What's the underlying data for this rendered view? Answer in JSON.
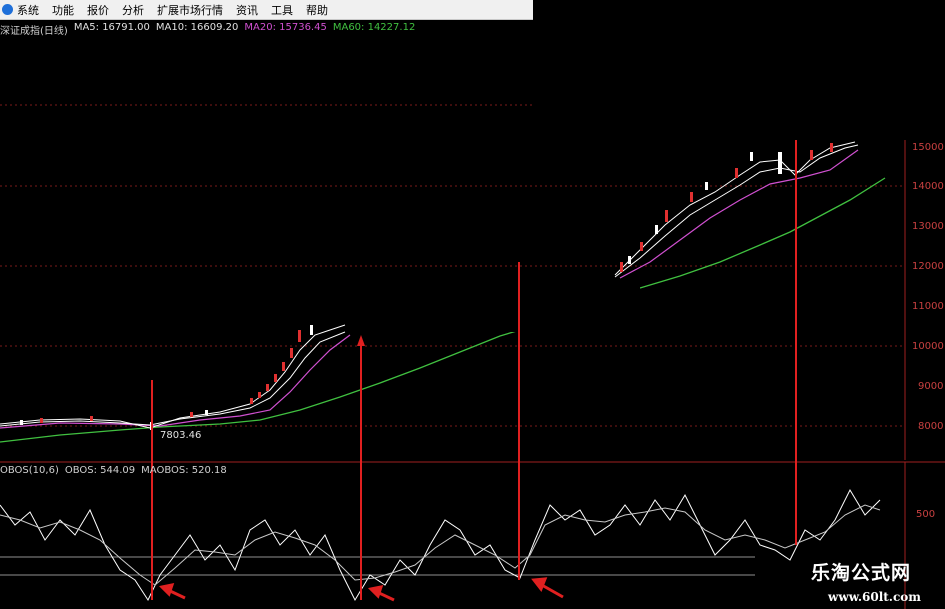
{
  "menu": {
    "items": [
      "系统",
      "功能",
      "报价",
      "分析",
      "扩展市场行情",
      "资讯",
      "工具",
      "帮助"
    ]
  },
  "price_legend": {
    "name": "深证成指(日线)",
    "ma5": "MA5: 16791.00",
    "ma10": "MA10: 16609.20",
    "ma20": "MA20: 15736.45",
    "ma60": "MA60: 14227.12"
  },
  "colors": {
    "ma5": "#ffffff",
    "ma10": "#ffffff",
    "ma20": "#d050d0",
    "ma60": "#40c040",
    "axis": "#c84040",
    "signal_line": "#e02020"
  },
  "low_price_label": "7803.46",
  "price_axis": [
    "15000",
    "14000",
    "13000",
    "12000",
    "11000",
    "10000",
    "9000",
    "8000"
  ],
  "obos_legend": {
    "name": "OBOS(10,6)",
    "obos": "OBOS: 544.09",
    "maobos": "MAOBOS: 520.18"
  },
  "obos_axis": [
    "500"
  ],
  "watermark": {
    "title": "乐淘公式网",
    "url": "www.60lt.com"
  }
}
